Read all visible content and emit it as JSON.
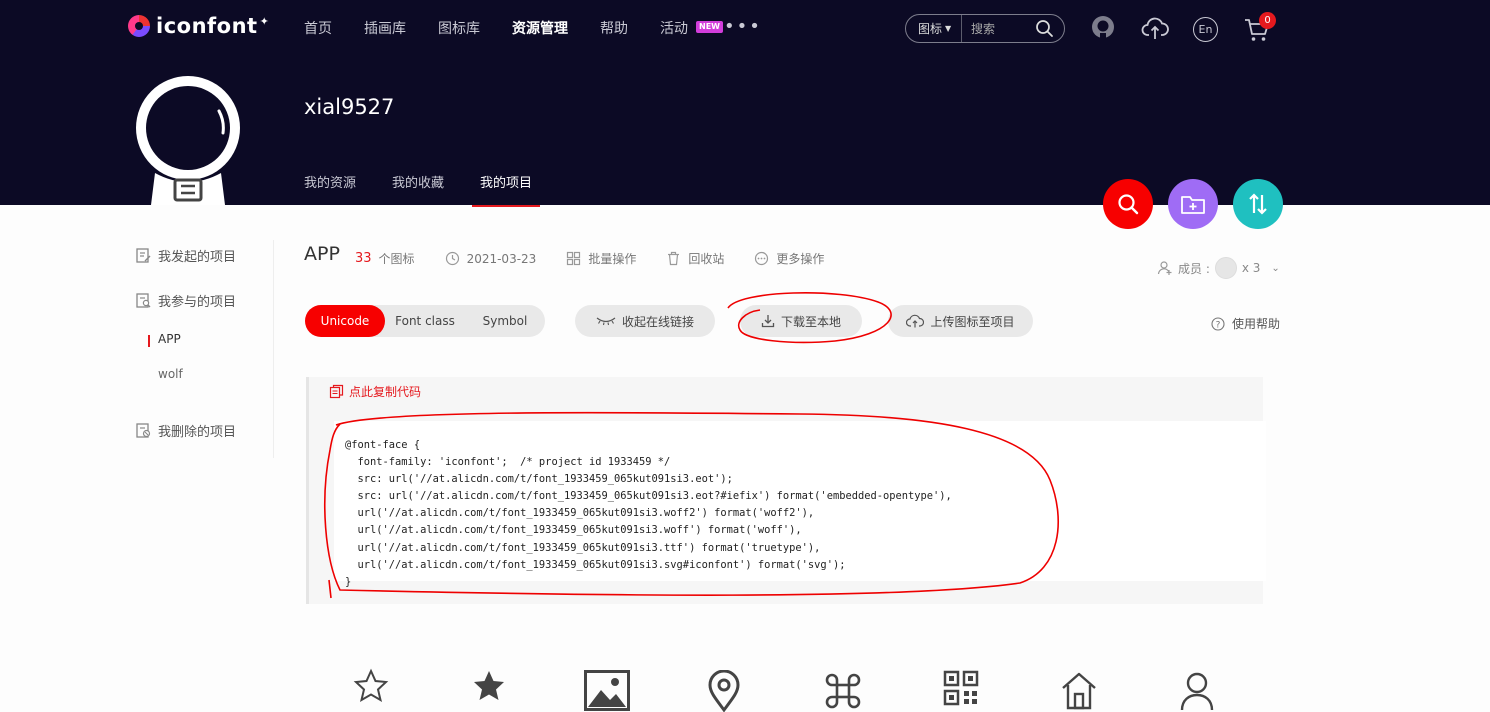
{
  "header": {
    "logo_text": "iconfont",
    "nav": [
      {
        "label": "首页"
      },
      {
        "label": "插画库"
      },
      {
        "label": "图标库"
      },
      {
        "label": "资源管理",
        "active": true
      },
      {
        "label": "帮助"
      },
      {
        "label": "活动",
        "badge": "NEW"
      }
    ],
    "more_label": "•••",
    "search": {
      "type_label": "图标",
      "placeholder": "搜索"
    },
    "cart_count": "0",
    "lang_label": "En"
  },
  "profile": {
    "username": "xial9527",
    "tabs": [
      {
        "label": "我的资源"
      },
      {
        "label": "我的收藏"
      },
      {
        "label": "我的项目",
        "active": true
      }
    ]
  },
  "sidebar": {
    "initiated": "我发起的项目",
    "joined": "我参与的项目",
    "projects": [
      {
        "label": "APP",
        "active": true
      },
      {
        "label": "wolf"
      }
    ],
    "deleted": "我删除的项目"
  },
  "project": {
    "title": "APP",
    "icon_count": "33",
    "icon_count_unit": "个图标",
    "date": "2021-03-23",
    "batch": "批量操作",
    "recycle": "回收站",
    "more": "更多操作",
    "members_label": "成员 :",
    "members_count": "x 3"
  },
  "toolbar": {
    "modes": [
      "Unicode",
      "Font class",
      "Symbol"
    ],
    "active_mode": "Unicode",
    "collapse_link": "收起在线链接",
    "download": "下载至本地",
    "upload": "上传图标至项目",
    "help": "使用帮助"
  },
  "code": {
    "copy_label": "点此复制代码",
    "text": "@font-face {\n  font-family: 'iconfont';  /* project id 1933459 */\n  src: url('//at.alicdn.com/t/font_1933459_065kut091si3.eot');\n  src: url('//at.alicdn.com/t/font_1933459_065kut091si3.eot?#iefix') format('embedded-opentype'),\n  url('//at.alicdn.com/t/font_1933459_065kut091si3.woff2') format('woff2'),\n  url('//at.alicdn.com/t/font_1933459_065kut091si3.woff') format('woff'),\n  url('//at.alicdn.com/t/font_1933459_065kut091si3.ttf') format('truetype'),\n  url('//at.alicdn.com/t/font_1933459_065kut091si3.svg#iconfont') format('svg');\n}"
  },
  "colors": {
    "header_bg": "#0c0a25",
    "accent_red": "#f70000",
    "fab_purple": "#9f6cf5",
    "fab_teal": "#1fc0c0"
  },
  "icon_grid": [
    "star-outline-icon",
    "star-filled-icon",
    "image-icon",
    "location-pin-icon",
    "command-icon",
    "qr-code-icon",
    "home-icon",
    "user-icon"
  ]
}
